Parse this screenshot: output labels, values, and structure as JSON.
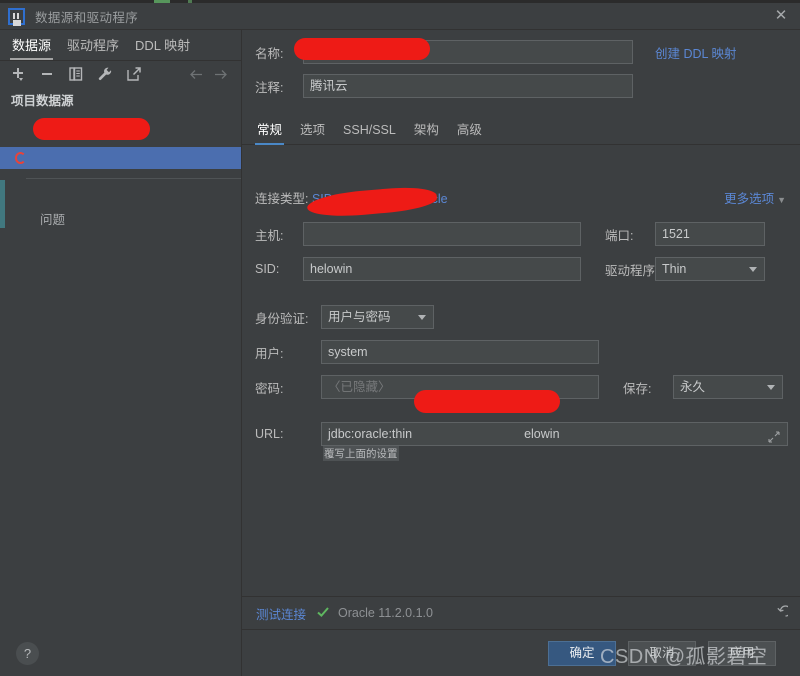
{
  "window": {
    "title": "数据源和驱动程序",
    "close_icon": "close-icon",
    "app_icon": "intellij-idea-logo"
  },
  "left_panel": {
    "tabs": [
      {
        "label": "数据源",
        "active": true
      },
      {
        "label": "驱动程序",
        "active": false
      },
      {
        "label": "DDL 映射",
        "active": false
      }
    ],
    "toolbar": [
      {
        "name": "add-icon",
        "glyph": "+"
      },
      {
        "name": "remove-icon",
        "glyph": "−"
      },
      {
        "name": "duplicate-icon",
        "glyph": "copy"
      },
      {
        "name": "wrench-icon",
        "glyph": "wrench"
      },
      {
        "name": "import-icon",
        "glyph": "external-link"
      },
      {
        "name": "back-arrow-icon",
        "glyph": "←"
      },
      {
        "name": "forward-arrow-icon",
        "glyph": "→"
      }
    ],
    "section_title": "项目数据源",
    "datasource_item": {
      "label": "",
      "icon": "oracle-database-icon",
      "selected": true
    },
    "problem_label": "问题"
  },
  "details": {
    "name_label": "名称:",
    "name_value": "",
    "name_color_indicator": "color-circle-icon",
    "create_ddl_mapping_link": "创建 DDL 映射",
    "comment_label": "注释:",
    "comment_value": "腾讯云",
    "expand_icon": "expand-icon",
    "tabs": [
      {
        "label": "常规",
        "active": true
      },
      {
        "label": "选项",
        "active": false
      },
      {
        "label": "SSH/SSL",
        "active": false
      },
      {
        "label": "架构",
        "active": false
      },
      {
        "label": "高级",
        "active": false
      }
    ],
    "connection": {
      "type_label": "连接类型:",
      "type_value": "SID",
      "driver_label": "驱动程序:",
      "driver_value": "Oracle",
      "more_options": "更多选项",
      "more_options_chevron": "chevron-down-icon"
    },
    "fields": {
      "host_label": "主机:",
      "host_value": "",
      "port_label": "端口:",
      "port_value": "1521",
      "sid_label": "SID:",
      "sid_value": "helowin",
      "driver_label": "驱动程序:",
      "driver_value": "Thin",
      "auth_label": "身份验证:",
      "auth_value": "用户与密码",
      "user_label": "用户:",
      "user_value": "system",
      "password_label": "密码:",
      "password_placeholder": "〈已隐藏〉",
      "save_label": "保存:",
      "save_value": "永久",
      "url_label": "URL:",
      "url_value_prefix": "jdbc:oracle:thin",
      "url_value_suffix": "elowin",
      "url_hint": "覆写上面的设置"
    }
  },
  "status_bar": {
    "test_connection_link": "测试连接",
    "success_icon": "checkmark-icon",
    "status_text": "Oracle 11.2.0.1.0",
    "revert_icon": "revert-icon"
  },
  "footer": {
    "help_label": "?",
    "ok_label": "确定",
    "cancel_label": "取消",
    "apply_label": "应用"
  },
  "watermark": "CSDN @孤影碧空",
  "colors": {
    "window_bg": "#3c3f41",
    "accent_blue": "#4b6eaf",
    "link_blue": "#5b87d4",
    "primary_button": "#365880",
    "field_bg": "#45494a",
    "redaction_red": "#ee1b16",
    "success_green": "#5fb760",
    "tab_underline": "#4a88c7"
  }
}
